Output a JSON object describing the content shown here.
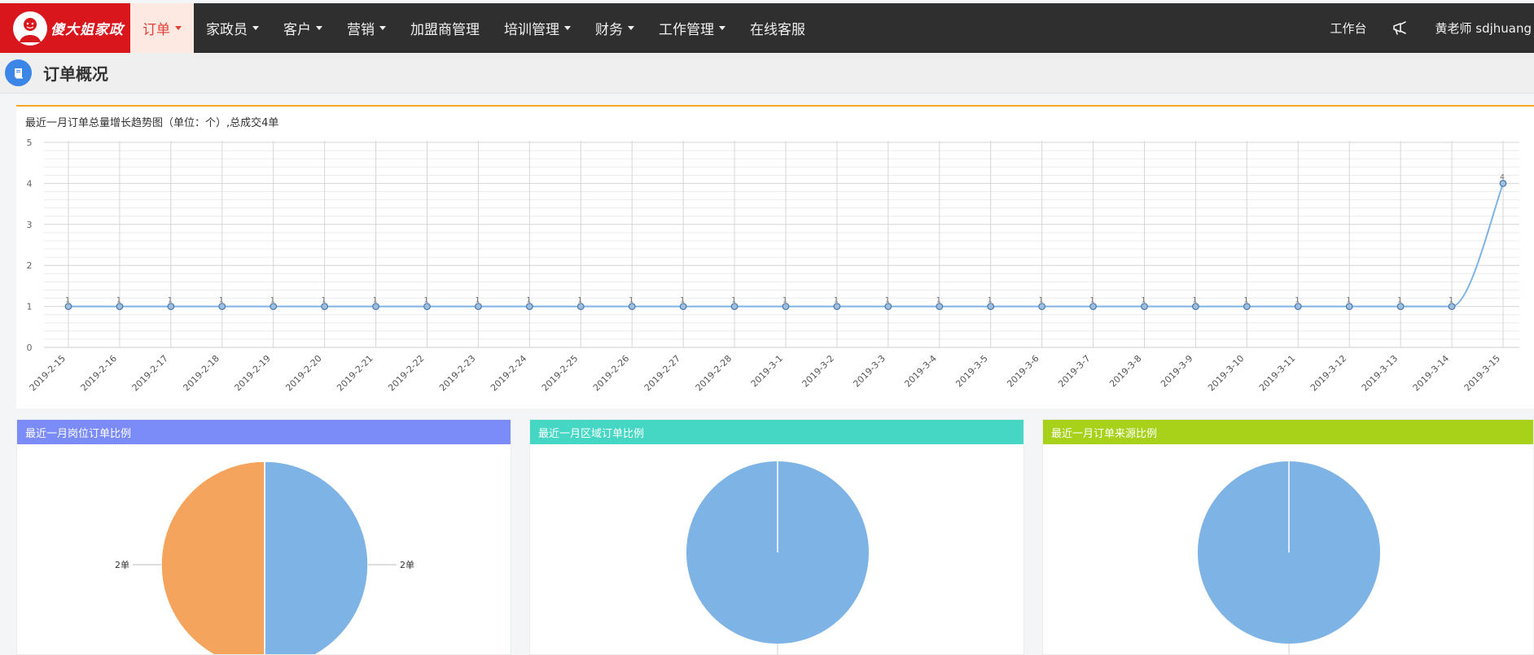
{
  "logo": {
    "text": "傻大姐家政"
  },
  "nav": {
    "menu": [
      {
        "label": "订单",
        "dropdown": true,
        "active": true
      },
      {
        "label": "家政员",
        "dropdown": true
      },
      {
        "label": "客户",
        "dropdown": true
      },
      {
        "label": "营销",
        "dropdown": true
      },
      {
        "label": "加盟商管理",
        "dropdown": false
      },
      {
        "label": "培训管理",
        "dropdown": true
      },
      {
        "label": "财务",
        "dropdown": true
      },
      {
        "label": "工作管理",
        "dropdown": true
      },
      {
        "label": "在线客服",
        "dropdown": false
      }
    ],
    "workbench": "工作台",
    "user": "黄老师 sdjhuang"
  },
  "page": {
    "title": "订单概况"
  },
  "trend": {
    "title": "最近一月订单总量增长趋势图（单位：个）,总成交4单",
    "chart_data": {
      "type": "line",
      "x": [
        "2019-2-15",
        "2019-2-16",
        "2019-2-17",
        "2019-2-18",
        "2019-2-19",
        "2019-2-20",
        "2019-2-21",
        "2019-2-22",
        "2019-2-23",
        "2019-2-24",
        "2019-2-25",
        "2019-2-26",
        "2019-2-27",
        "2019-2-28",
        "2019-3-1",
        "2019-3-2",
        "2019-3-3",
        "2019-3-4",
        "2019-3-5",
        "2019-3-6",
        "2019-3-7",
        "2019-3-8",
        "2019-3-9",
        "2019-3-10",
        "2019-3-11",
        "2019-3-12",
        "2019-3-13",
        "2019-3-14",
        "2019-3-15"
      ],
      "values": [
        1,
        1,
        1,
        1,
        1,
        1,
        1,
        1,
        1,
        1,
        1,
        1,
        1,
        1,
        1,
        1,
        1,
        1,
        1,
        1,
        1,
        1,
        1,
        1,
        1,
        1,
        1,
        1,
        4
      ],
      "ylim": [
        0,
        5
      ],
      "yticks": [
        0,
        1,
        2,
        3,
        4,
        5
      ],
      "grid": true,
      "line_color": "#7eb3e6"
    }
  },
  "pies": [
    {
      "title": "最近一月岗位订单比例",
      "header_color": "#7b8cf8",
      "chart_data": {
        "type": "pie",
        "slices": [
          {
            "label": "2单",
            "value": 2,
            "color": "#7eb3e6"
          },
          {
            "label": "2单",
            "value": 2,
            "color": "#f5a45d"
          }
        ]
      }
    },
    {
      "title": "最近一月区域订单比例",
      "header_color": "#45d6c4",
      "chart_data": {
        "type": "pie",
        "slices": [
          {
            "label": "",
            "value": 1,
            "color": "#7eb3e6"
          }
        ]
      }
    },
    {
      "title": "最近一月订单来源比例",
      "header_color": "#a8d11a",
      "chart_data": {
        "type": "pie",
        "slices": [
          {
            "label": "",
            "value": 1,
            "color": "#7eb3e6"
          }
        ]
      }
    }
  ]
}
